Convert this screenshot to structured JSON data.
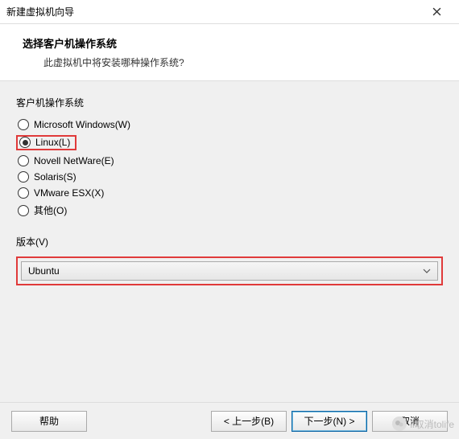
{
  "window": {
    "title": "新建虚拟机向导"
  },
  "header": {
    "title": "选择客户机操作系统",
    "subtitle": "此虚拟机中将安装哪种操作系统?"
  },
  "os_group": {
    "label": "客户机操作系统",
    "options": [
      {
        "label": "Microsoft Windows(W)",
        "selected": false,
        "highlight": false
      },
      {
        "label": "Linux(L)",
        "selected": true,
        "highlight": true
      },
      {
        "label": "Novell NetWare(E)",
        "selected": false,
        "highlight": false
      },
      {
        "label": "Solaris(S)",
        "selected": false,
        "highlight": false
      },
      {
        "label": "VMware ESX(X)",
        "selected": false,
        "highlight": false
      },
      {
        "label": "其他(O)",
        "selected": false,
        "highlight": false
      }
    ]
  },
  "version": {
    "label": "版本(V)",
    "selected": "Ubuntu"
  },
  "buttons": {
    "help": "帮助",
    "back": "< 上一步(B)",
    "next": "下一步(N) >",
    "cancel": "取消"
  },
  "watermark": "li取消tolife"
}
